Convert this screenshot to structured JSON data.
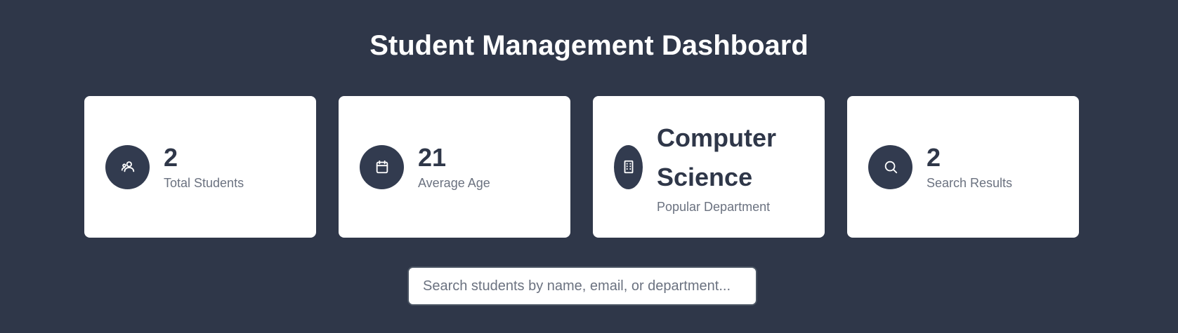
{
  "header": {
    "title": "Student Management Dashboard"
  },
  "stats": [
    {
      "value": "2",
      "label": "Total Students",
      "icon": "users-icon"
    },
    {
      "value": "21",
      "label": "Average Age",
      "icon": "calendar-icon"
    },
    {
      "value": "Computer Science",
      "label": "Popular Department",
      "icon": "building-icon"
    },
    {
      "value": "2",
      "label": "Search Results",
      "icon": "search-icon"
    }
  ],
  "search": {
    "placeholder": "Search students by name, email, or department...",
    "value": ""
  },
  "colors": {
    "background": "#2f3749",
    "card": "#ffffff",
    "icon_circle": "#323b4f",
    "value_text": "#2f3749",
    "label_text": "#6b7280"
  }
}
